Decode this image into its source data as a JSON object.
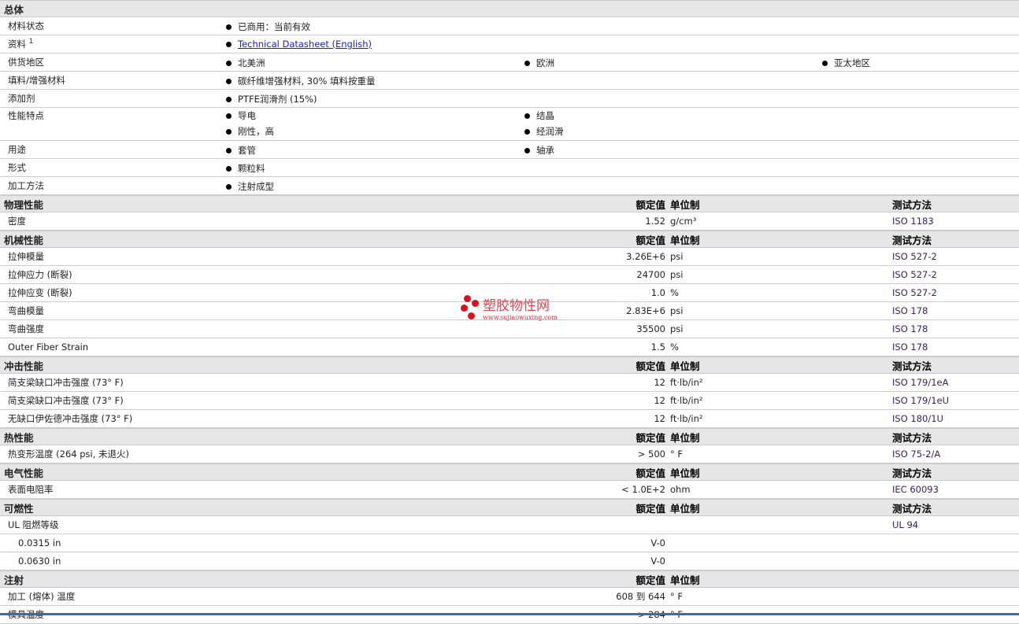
{
  "general": {
    "title": "总体",
    "rows": [
      {
        "label": "材料状态",
        "items": [
          "已商用：当前有效"
        ]
      },
      {
        "label": "资料",
        "sup": "1",
        "items": [
          "Technical Datasheet (English)"
        ],
        "link": true
      },
      {
        "label": "供货地区",
        "items": [
          "北美洲",
          "欧洲",
          "亚太地区"
        ]
      },
      {
        "label": "填料/增强材料",
        "items": [
          "碳纤维增强材料, 30% 填料按重量"
        ]
      },
      {
        "label": "添加剂",
        "items": [
          "PTFE润滑剂 (15%)"
        ]
      },
      {
        "label": "性能特点",
        "items": [
          "导电",
          "结晶",
          "刚性，高",
          "经润滑"
        ],
        "tall": true
      },
      {
        "label": "用途",
        "items": [
          "套管",
          "轴承"
        ]
      },
      {
        "label": "形式",
        "items": [
          "颗粒料"
        ]
      },
      {
        "label": "加工方法",
        "items": [
          "注射成型"
        ]
      }
    ]
  },
  "headers": {
    "value": "额定值",
    "unit": "单位制",
    "test": "测试方法"
  },
  "sections": [
    {
      "title": "物理性能",
      "test_header": true,
      "rows": [
        {
          "label": "密度",
          "value": "1.52",
          "unit": "g/cm³",
          "test": "ISO 1183"
        }
      ]
    },
    {
      "title": "机械性能",
      "test_header": true,
      "rows": [
        {
          "label": "拉伸模量",
          "value": "3.26E+6",
          "unit": "psi",
          "test": "ISO 527-2"
        },
        {
          "label": "拉伸应力 (断裂)",
          "value": "24700",
          "unit": "psi",
          "test": "ISO 527-2"
        },
        {
          "label": "拉伸应变 (断裂)",
          "value": "1.0",
          "unit": "%",
          "test": "ISO 527-2"
        },
        {
          "label": "弯曲模量",
          "value": "2.83E+6",
          "unit": "psi",
          "test": "ISO 178"
        },
        {
          "label": "弯曲强度",
          "value": "35500",
          "unit": "psi",
          "test": "ISO 178"
        },
        {
          "label": "Outer Fiber Strain",
          "value": "1.5",
          "unit": "%",
          "test": "ISO 178"
        }
      ]
    },
    {
      "title": "冲击性能",
      "test_header": true,
      "rows": [
        {
          "label": "简支梁缺口冲击强度 (73° F)",
          "value": "12",
          "unit": "ft·lb/in²",
          "test": "ISO 179/1eA"
        },
        {
          "label": "简支梁缺口冲击强度 (73° F)",
          "value": "12",
          "unit": "ft·lb/in²",
          "test": "ISO 179/1eU"
        },
        {
          "label": "无缺口伊佐德冲击强度 (73° F)",
          "value": "12",
          "unit": "ft·lb/in²",
          "test": "ISO 180/1U"
        }
      ]
    },
    {
      "title": "热性能",
      "test_header": true,
      "rows": [
        {
          "label": "热变形温度 (264 psi, 未退火)",
          "value": "> 500",
          "unit": "° F",
          "test": "ISO 75-2/A"
        }
      ]
    },
    {
      "title": "电气性能",
      "test_header": true,
      "rows": [
        {
          "label": "表面电阻率",
          "value": "< 1.0E+2",
          "unit": "ohm",
          "test": "IEC 60093"
        }
      ]
    },
    {
      "title": "可燃性",
      "test_header": true,
      "rows": [
        {
          "label": "UL 阻燃等级",
          "value": "",
          "unit": "",
          "test": "UL 94"
        },
        {
          "label": "0.0315 in",
          "value": "V-0",
          "unit": "",
          "test": "",
          "indent": true
        },
        {
          "label": "0.0630 in",
          "value": "V-0",
          "unit": "",
          "test": "",
          "indent": true
        }
      ]
    },
    {
      "title": "注射",
      "test_header": false,
      "rows": [
        {
          "label": "加工 (熔体) 温度",
          "value": "608 到 644",
          "unit": "° F",
          "test": ""
        },
        {
          "label": "模具温度",
          "value": "> 284",
          "unit": "° F",
          "test": ""
        }
      ]
    }
  ],
  "watermark": {
    "name": "塑胶物性网",
    "url": "www.sujiaowuxing.com"
  }
}
